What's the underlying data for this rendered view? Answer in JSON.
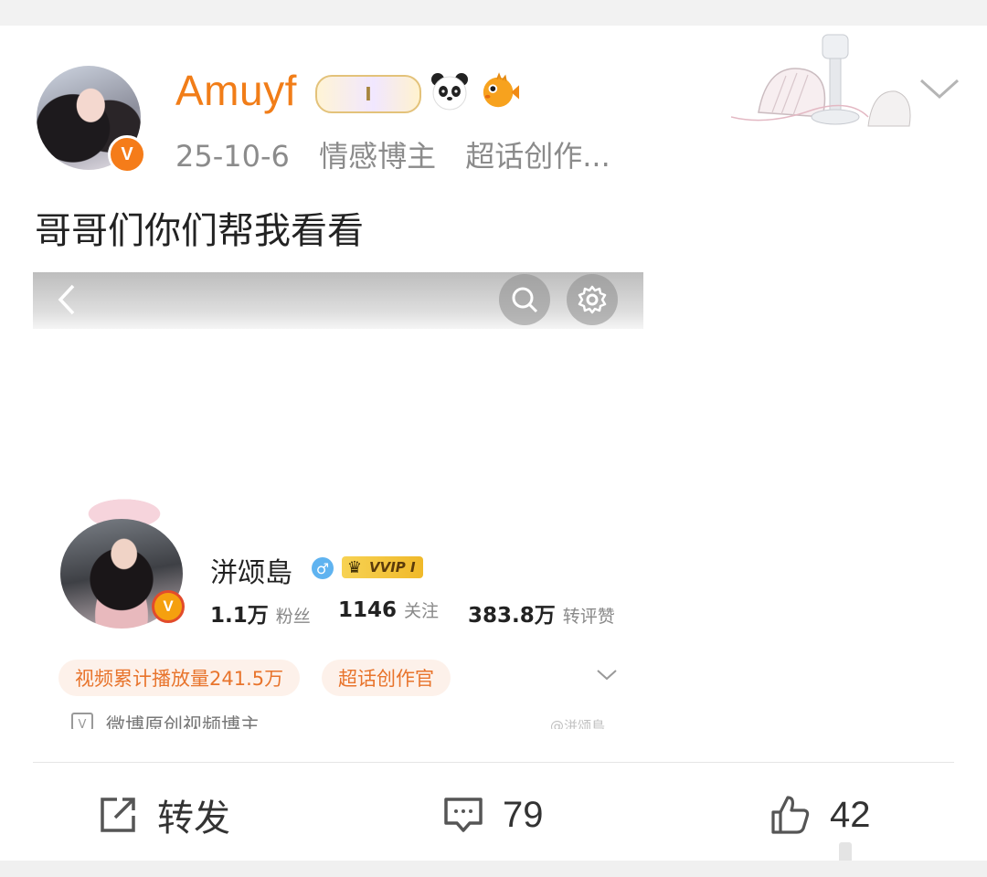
{
  "post": {
    "username": "Amuyf",
    "level_badge": "I",
    "date": "25-10-6",
    "tags": [
      "情感博主",
      "超话创作..."
    ],
    "text": "哥哥们你们帮我看看",
    "accent_color": "#f17d18"
  },
  "screenshot": {
    "profile_name": "洴颂島",
    "vip_label": "VVIP I",
    "stats": [
      {
        "value": "1.1万",
        "label": "粉丝"
      },
      {
        "value": "1146",
        "label": "关注"
      },
      {
        "value": "383.8万",
        "label": "转评赞"
      }
    ],
    "tags": [
      "视频累计播放量241.5万",
      "超话创作官"
    ],
    "certification": "微博原创视频博主",
    "watermark": "@洴颂島"
  },
  "actions": {
    "repost_label": "转发",
    "comments_count": "79",
    "likes_count": "42"
  }
}
